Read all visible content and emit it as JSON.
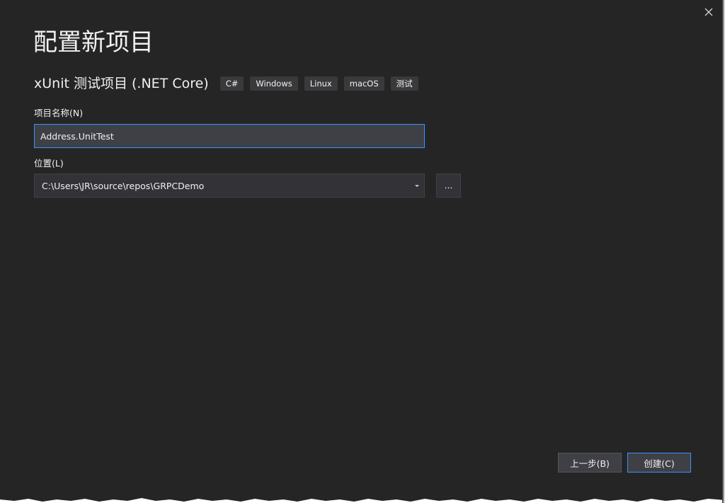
{
  "dialog": {
    "title": "配置新项目",
    "close_icon": "close-icon"
  },
  "template": {
    "name": "xUnit 测试项目 (.NET Core)",
    "tags": [
      "C#",
      "Windows",
      "Linux",
      "macOS",
      "测试"
    ]
  },
  "project_name": {
    "label": "项目名称(N)",
    "value": "Address.UnitTest"
  },
  "location": {
    "label": "位置(L)",
    "value": "C:\\Users\\JR\\source\\repos\\GRPCDemo",
    "dropdown_icon": "chevron-down-icon",
    "browse_label": "..."
  },
  "footer": {
    "back_label": "上一步(B)",
    "create_label": "创建(C)"
  },
  "colors": {
    "background": "#252526",
    "accent": "#3794ff",
    "control": "#3f3f46",
    "tag": "#3a3a3d"
  }
}
